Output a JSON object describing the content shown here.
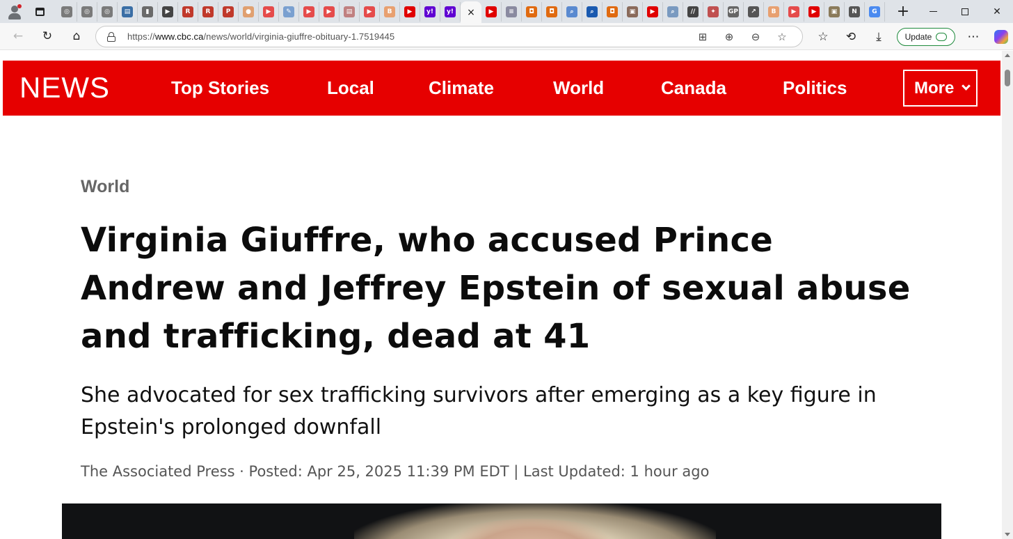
{
  "browser": {
    "active_tab_close": "×",
    "new_tab": "+",
    "tab_favicons": [
      {
        "icon": "globe-icon",
        "color": "#7a7a7a",
        "glyph": "◎"
      },
      {
        "icon": "globe-icon",
        "color": "#7a7a7a",
        "glyph": "◎"
      },
      {
        "icon": "globe-icon",
        "color": "#7a7a7a",
        "glyph": "◎"
      },
      {
        "icon": "newspaper-icon",
        "color": "#3a6ea5",
        "glyph": "▤"
      },
      {
        "icon": "book-icon",
        "color": "#6a6a6a",
        "glyph": "▮"
      },
      {
        "icon": "arrow-icon",
        "color": "#444444",
        "glyph": "▶"
      },
      {
        "icon": "r-logo-icon",
        "color": "#c0392b",
        "glyph": "R"
      },
      {
        "icon": "r-logo-icon",
        "color": "#c0392b",
        "glyph": "R"
      },
      {
        "icon": "pdf-icon",
        "color": "#c0392b",
        "glyph": "P"
      },
      {
        "icon": "circle-icon",
        "color": "#e0a070",
        "glyph": "●"
      },
      {
        "icon": "youtube-icon",
        "color": "#e54b4b",
        "glyph": "▶"
      },
      {
        "icon": "feather-icon",
        "color": "#7aa0d0",
        "glyph": "✎"
      },
      {
        "icon": "youtube-icon",
        "color": "#e54b4b",
        "glyph": "▶"
      },
      {
        "icon": "youtube-icon",
        "color": "#e54b4b",
        "glyph": "▶"
      },
      {
        "icon": "document-icon",
        "color": "#c08080",
        "glyph": "▤"
      },
      {
        "icon": "youtube-icon",
        "color": "#e54b4b",
        "glyph": "▶"
      },
      {
        "icon": "b-logo-icon",
        "color": "#e8a070",
        "glyph": "B"
      },
      {
        "icon": "youtube-icon",
        "color": "#e00000",
        "glyph": "▶"
      },
      {
        "icon": "yahoo-icon",
        "color": "#6001d2",
        "glyph": "y!"
      },
      {
        "icon": "yahoo-icon",
        "color": "#6001d2",
        "glyph": "y!"
      }
    ],
    "tab_favicons_after": [
      {
        "icon": "youtube-icon",
        "color": "#e00000",
        "glyph": "▶"
      },
      {
        "icon": "list-icon",
        "color": "#8a8aa0",
        "glyph": "≡"
      },
      {
        "icon": "bookmark-icon",
        "color": "#e06a10",
        "glyph": "◘"
      },
      {
        "icon": "bookmark-icon",
        "color": "#e06a10",
        "glyph": "◘"
      },
      {
        "icon": "search-icon",
        "color": "#5a8ad0",
        "glyph": "⌕"
      },
      {
        "icon": "search-icon",
        "color": "#1a5ab0",
        "glyph": "⌕"
      },
      {
        "icon": "bookmark-icon",
        "color": "#e06a10",
        "glyph": "◘"
      },
      {
        "icon": "photo-icon",
        "color": "#8a6a5a",
        "glyph": "▣"
      },
      {
        "icon": "youtube-icon",
        "color": "#e00000",
        "glyph": "▶"
      },
      {
        "icon": "search-icon",
        "color": "#7a9ac0",
        "glyph": "⌕"
      },
      {
        "icon": "slashes-icon",
        "color": "#444444",
        "glyph": "//"
      },
      {
        "icon": "bird-icon",
        "color": "#c05050",
        "glyph": "✦"
      },
      {
        "icon": "gp-icon",
        "color": "#666666",
        "glyph": "GP"
      },
      {
        "icon": "chart-icon",
        "color": "#555555",
        "glyph": "↗"
      },
      {
        "icon": "b-logo-icon",
        "color": "#e8a070",
        "glyph": "B"
      },
      {
        "icon": "youtube-icon",
        "color": "#e54b4b",
        "glyph": "▶"
      },
      {
        "icon": "youtube-icon",
        "color": "#e00000",
        "glyph": "▶"
      },
      {
        "icon": "photo-icon",
        "color": "#8a7a5a",
        "glyph": "▣"
      },
      {
        "icon": "n-logo-icon",
        "color": "#555555",
        "glyph": "N"
      },
      {
        "icon": "g-logo-icon",
        "color": "#4a8af0",
        "glyph": "G"
      }
    ],
    "url_prefix": "https://",
    "url_domain": "www.cbc.ca",
    "url_path": "/news/world/virginia-giuffre-obituary-1.7519445",
    "update_label": "Update"
  },
  "site": {
    "logo": "NEWS",
    "nav": [
      {
        "label": "Top Stories"
      },
      {
        "label": "Local"
      },
      {
        "label": "Climate"
      },
      {
        "label": "World"
      },
      {
        "label": "Canada"
      },
      {
        "label": "Politics"
      }
    ],
    "more_label": "More",
    "brand_color": "#e60000"
  },
  "article": {
    "category": "World",
    "headline": "Virginia Giuffre, who accused Prince Andrew and Jeffrey Epstein of sexual abuse and trafficking, dead at 41",
    "dek": "She advocated for sex trafficking survivors after emerging as a key figure in Epstein's prolonged downfall",
    "byline": "The Associated Press · Posted: Apr 25, 2025 11:39 PM EDT | Last Updated: 1 hour ago"
  }
}
